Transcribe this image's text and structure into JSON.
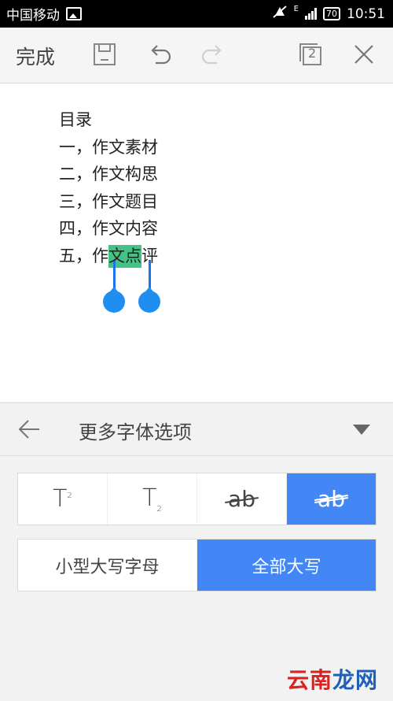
{
  "status_bar": {
    "carrier": "中国移动",
    "network": "E",
    "battery": "70",
    "time": "10:51"
  },
  "toolbar": {
    "done_label": "完成",
    "page_count": "2"
  },
  "document": {
    "lines": [
      "目录",
      "一，作文素材",
      "二，作文构思",
      "三，作文题目",
      "四，作文内容"
    ],
    "last_line": {
      "before": "五，作",
      "selected": "文点",
      "after": "评"
    },
    "selection_color": "#21b970"
  },
  "panel": {
    "title": "更多字体选项",
    "format_options": [
      {
        "name": "superscript",
        "active": false
      },
      {
        "name": "subscript",
        "active": false
      },
      {
        "name": "strikethrough",
        "active": false
      },
      {
        "name": "double-strikethrough",
        "active": true
      }
    ],
    "caps_options": {
      "small_caps": "小型大写字母",
      "all_caps": "全部大写"
    },
    "accent_color": "#4287f5"
  },
  "watermark": {
    "part1": "云南",
    "part2": "龙网"
  }
}
